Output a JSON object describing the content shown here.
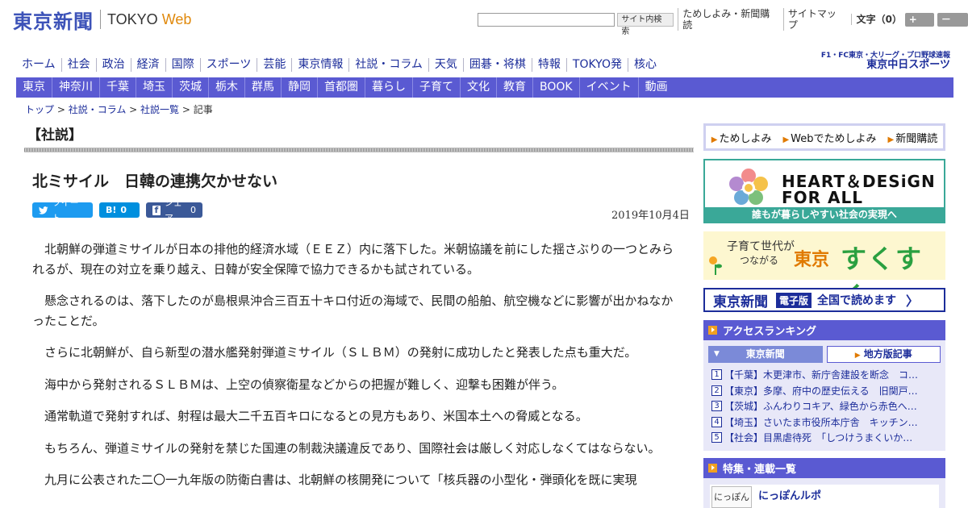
{
  "header": {
    "logo_jp": "東京新聞",
    "logo_en": "TOKYO",
    "logo_web": "Web",
    "search_placeholder": "",
    "search_button": "サイト内検索",
    "links": [
      "ためしよみ・新聞購読",
      "サイトマップ"
    ],
    "font_size_label": "文字（0）",
    "font_plus": "+ 大",
    "font_minus": "－ 小"
  },
  "mainnav": [
    "ホーム",
    "社会",
    "政治",
    "経済",
    "国際",
    "スポーツ",
    "芸能",
    "東京情報",
    "社説・コラム",
    "天気",
    "囲碁・将棋",
    "特報",
    "TOKYO発",
    "核心"
  ],
  "sports_logo": {
    "line1": "F1・FC東京・大リーグ・プロ野球速報",
    "line2": "東京中日スポーツ"
  },
  "subnav": [
    "東京",
    "神奈川",
    "千葉",
    "埼玉",
    "茨城",
    "栃木",
    "群馬",
    "静岡",
    "首都圏",
    "暮らし",
    "子育て",
    "文化",
    "教育",
    "BOOK",
    "イベント",
    "動画"
  ],
  "breadcrumb": {
    "items": [
      "トップ",
      "社説・コラム",
      "社説一覧"
    ],
    "sep": " > ",
    "current": "記事"
  },
  "section_title": "【社説】",
  "article": {
    "title": "北ミサイル　日韓の連携欠かせない",
    "date": "2019年10月4日",
    "share": {
      "tweet": "ツイート",
      "hatena_label": "B!",
      "hatena_count": "0",
      "fb_label": "シェア",
      "fb_count": "0"
    },
    "paragraphs": [
      "北朝鮮の弾道ミサイルが日本の排他的経済水域（ＥＥＺ）内に落下した。米朝協議を前にした揺さぶりの一つとみられるが、現在の対立を乗り越え、日韓が安全保障で協力できるかも試されている。",
      "懸念されるのは、落下したのが島根県沖合三百五十キロ付近の海域で、民間の船舶、航空機などに影響が出かねなかったことだ。",
      "さらに北朝鮮が、自ら新型の潜水艦発射弾道ミサイル（ＳＬＢＭ）の発射に成功したと発表した点も重大だ。",
      "海中から発射されるＳＬＢＭは、上空の偵察衛星などからの把握が難しく、迎撃も困難が伴う。",
      "通常軌道で発射すれば、射程は最大二千五百キロになるとの見方もあり、米国本土への脅威となる。",
      "もちろん、弾道ミサイルの発射を禁じた国連の制裁決議違反であり、国際社会は厳しく対応しなくてはならない。",
      "九月に公表された二〇一九年版の防衛白書は、北朝鮮の核開発について「核兵器の小型化・弾頭化を既に実現"
    ]
  },
  "sidebar": {
    "trial": [
      "ためしよみ",
      "Webでためしよみ",
      "新聞購読"
    ],
    "heart": {
      "line1": "HEART＆DESiGN",
      "line2": "FOR ALL",
      "strip": "誰もが暮らしやすい社会の実現へ"
    },
    "sukusuku": {
      "t1": "子育て世代が",
      "t2": "つながる",
      "t3": "東京",
      "t4": "すくすく"
    },
    "denshi": {
      "name": "東京新聞",
      "badge": "電子版",
      "text": "全国で読めます",
      "arrow": "〉"
    },
    "ranking": {
      "title": "アクセスランキング",
      "tabs": [
        "東京新聞",
        "地方版記事"
      ],
      "items": [
        {
          "n": "1",
          "text": "【千葉】木更津市、新庁舎建設を断念　コ…"
        },
        {
          "n": "2",
          "text": "【東京】多摩、府中の歴史伝える　旧関戸…"
        },
        {
          "n": "3",
          "text": "【茨城】ふんわりコキア、緑色から赤色へ…"
        },
        {
          "n": "4",
          "text": "【埼玉】さいたま市役所本庁舎　キッチン…"
        },
        {
          "n": "5",
          "text": "【社会】目黒虐待死　「しつけうまくいか…"
        }
      ]
    },
    "tokushu": {
      "title": "特集・連載一覧",
      "item_title": "にっぽんルポ",
      "item_img_label": "にっぽん"
    }
  },
  "colors": {
    "brand_blue": "#3c52b8",
    "nav_purple": "#5a5ad2",
    "accent_orange": "#e07a00",
    "heart_teal": "#3aa898"
  }
}
